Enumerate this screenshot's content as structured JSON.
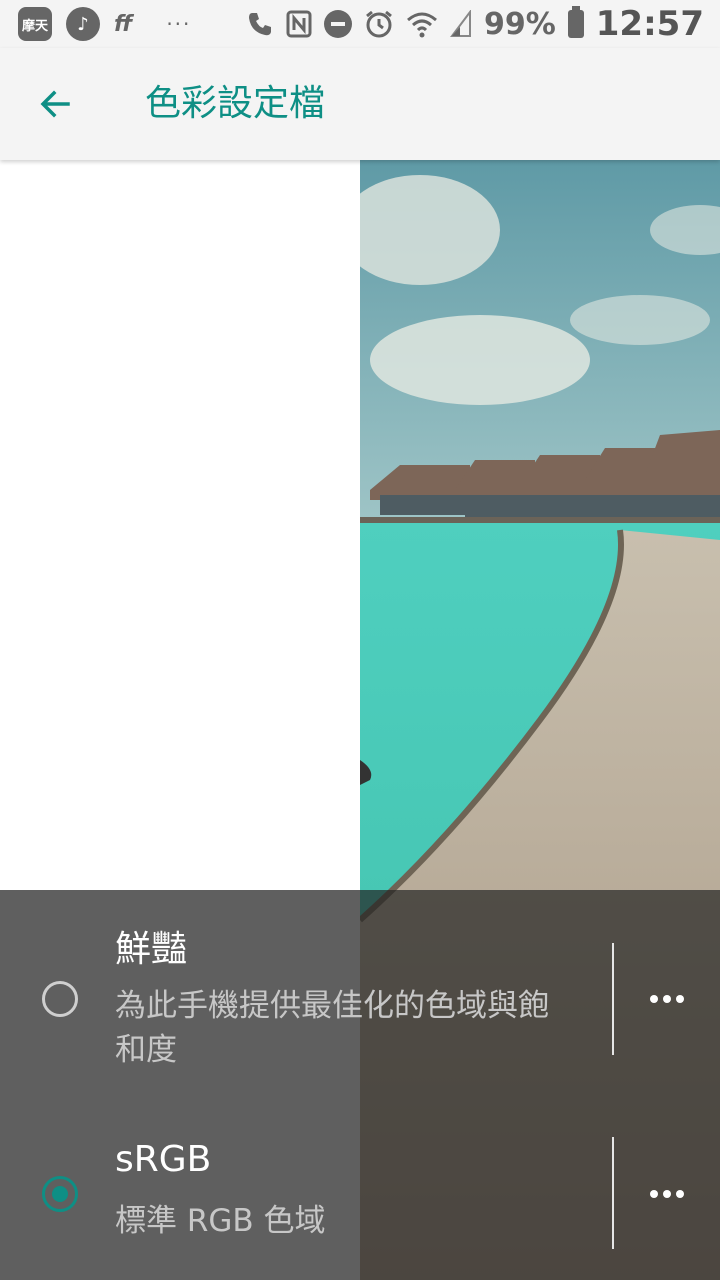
{
  "status_bar": {
    "app_icon_label": "摩天",
    "battery": "99%",
    "time": "12:57",
    "dots": "···"
  },
  "app_bar": {
    "title": "色彩設定檔",
    "back_icon": "arrow-left-icon"
  },
  "options": [
    {
      "title": "鮮豔",
      "description": "為此手機提供最佳化的色域與飽和度",
      "selected": false
    },
    {
      "title": "sRGB",
      "description": "標準 RGB 色域",
      "selected": true
    }
  ],
  "colors": {
    "accent": "#0e8f85",
    "panel": "#5f5f5f"
  }
}
